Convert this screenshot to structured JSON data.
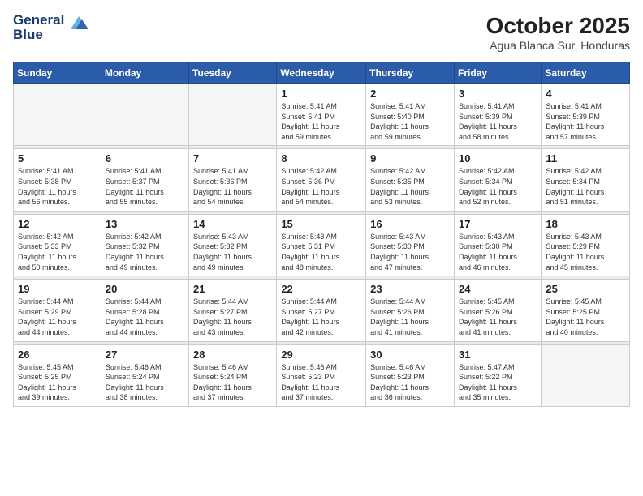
{
  "header": {
    "logo_line1": "General",
    "logo_line2": "Blue",
    "month_title": "October 2025",
    "subtitle": "Agua Blanca Sur, Honduras"
  },
  "weekdays": [
    "Sunday",
    "Monday",
    "Tuesday",
    "Wednesday",
    "Thursday",
    "Friday",
    "Saturday"
  ],
  "weeks": [
    [
      {
        "day": "",
        "info": ""
      },
      {
        "day": "",
        "info": ""
      },
      {
        "day": "",
        "info": ""
      },
      {
        "day": "1",
        "info": "Sunrise: 5:41 AM\nSunset: 5:41 PM\nDaylight: 11 hours\nand 59 minutes."
      },
      {
        "day": "2",
        "info": "Sunrise: 5:41 AM\nSunset: 5:40 PM\nDaylight: 11 hours\nand 59 minutes."
      },
      {
        "day": "3",
        "info": "Sunrise: 5:41 AM\nSunset: 5:39 PM\nDaylight: 11 hours\nand 58 minutes."
      },
      {
        "day": "4",
        "info": "Sunrise: 5:41 AM\nSunset: 5:39 PM\nDaylight: 11 hours\nand 57 minutes."
      }
    ],
    [
      {
        "day": "5",
        "info": "Sunrise: 5:41 AM\nSunset: 5:38 PM\nDaylight: 11 hours\nand 56 minutes."
      },
      {
        "day": "6",
        "info": "Sunrise: 5:41 AM\nSunset: 5:37 PM\nDaylight: 11 hours\nand 55 minutes."
      },
      {
        "day": "7",
        "info": "Sunrise: 5:41 AM\nSunset: 5:36 PM\nDaylight: 11 hours\nand 54 minutes."
      },
      {
        "day": "8",
        "info": "Sunrise: 5:42 AM\nSunset: 5:36 PM\nDaylight: 11 hours\nand 54 minutes."
      },
      {
        "day": "9",
        "info": "Sunrise: 5:42 AM\nSunset: 5:35 PM\nDaylight: 11 hours\nand 53 minutes."
      },
      {
        "day": "10",
        "info": "Sunrise: 5:42 AM\nSunset: 5:34 PM\nDaylight: 11 hours\nand 52 minutes."
      },
      {
        "day": "11",
        "info": "Sunrise: 5:42 AM\nSunset: 5:34 PM\nDaylight: 11 hours\nand 51 minutes."
      }
    ],
    [
      {
        "day": "12",
        "info": "Sunrise: 5:42 AM\nSunset: 5:33 PM\nDaylight: 11 hours\nand 50 minutes."
      },
      {
        "day": "13",
        "info": "Sunrise: 5:42 AM\nSunset: 5:32 PM\nDaylight: 11 hours\nand 49 minutes."
      },
      {
        "day": "14",
        "info": "Sunrise: 5:43 AM\nSunset: 5:32 PM\nDaylight: 11 hours\nand 49 minutes."
      },
      {
        "day": "15",
        "info": "Sunrise: 5:43 AM\nSunset: 5:31 PM\nDaylight: 11 hours\nand 48 minutes."
      },
      {
        "day": "16",
        "info": "Sunrise: 5:43 AM\nSunset: 5:30 PM\nDaylight: 11 hours\nand 47 minutes."
      },
      {
        "day": "17",
        "info": "Sunrise: 5:43 AM\nSunset: 5:30 PM\nDaylight: 11 hours\nand 46 minutes."
      },
      {
        "day": "18",
        "info": "Sunrise: 5:43 AM\nSunset: 5:29 PM\nDaylight: 11 hours\nand 45 minutes."
      }
    ],
    [
      {
        "day": "19",
        "info": "Sunrise: 5:44 AM\nSunset: 5:29 PM\nDaylight: 11 hours\nand 44 minutes."
      },
      {
        "day": "20",
        "info": "Sunrise: 5:44 AM\nSunset: 5:28 PM\nDaylight: 11 hours\nand 44 minutes."
      },
      {
        "day": "21",
        "info": "Sunrise: 5:44 AM\nSunset: 5:27 PM\nDaylight: 11 hours\nand 43 minutes."
      },
      {
        "day": "22",
        "info": "Sunrise: 5:44 AM\nSunset: 5:27 PM\nDaylight: 11 hours\nand 42 minutes."
      },
      {
        "day": "23",
        "info": "Sunrise: 5:44 AM\nSunset: 5:26 PM\nDaylight: 11 hours\nand 41 minutes."
      },
      {
        "day": "24",
        "info": "Sunrise: 5:45 AM\nSunset: 5:26 PM\nDaylight: 11 hours\nand 41 minutes."
      },
      {
        "day": "25",
        "info": "Sunrise: 5:45 AM\nSunset: 5:25 PM\nDaylight: 11 hours\nand 40 minutes."
      }
    ],
    [
      {
        "day": "26",
        "info": "Sunrise: 5:45 AM\nSunset: 5:25 PM\nDaylight: 11 hours\nand 39 minutes."
      },
      {
        "day": "27",
        "info": "Sunrise: 5:46 AM\nSunset: 5:24 PM\nDaylight: 11 hours\nand 38 minutes."
      },
      {
        "day": "28",
        "info": "Sunrise: 5:46 AM\nSunset: 5:24 PM\nDaylight: 11 hours\nand 37 minutes."
      },
      {
        "day": "29",
        "info": "Sunrise: 5:46 AM\nSunset: 5:23 PM\nDaylight: 11 hours\nand 37 minutes."
      },
      {
        "day": "30",
        "info": "Sunrise: 5:46 AM\nSunset: 5:23 PM\nDaylight: 11 hours\nand 36 minutes."
      },
      {
        "day": "31",
        "info": "Sunrise: 5:47 AM\nSunset: 5:22 PM\nDaylight: 11 hours\nand 35 minutes."
      },
      {
        "day": "",
        "info": ""
      }
    ]
  ]
}
